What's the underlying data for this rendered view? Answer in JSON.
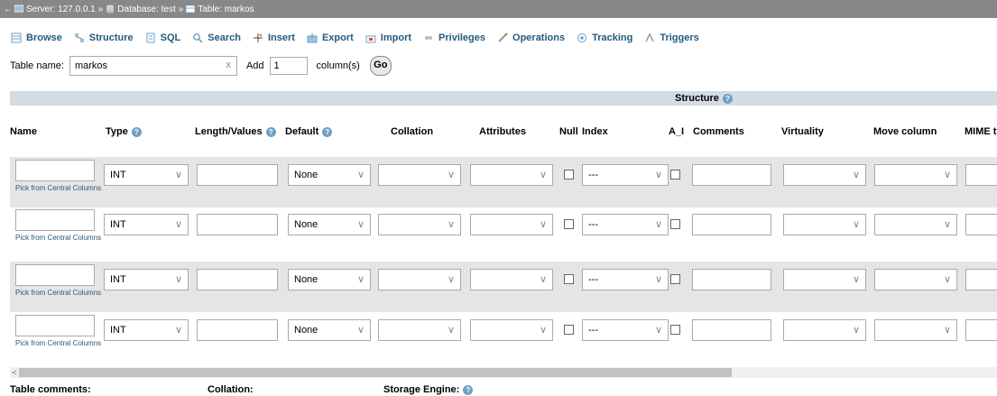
{
  "breadcrumb": {
    "server": "Server: 127.0.0.1",
    "database": "Database: test",
    "table": "Table: markos",
    "sep": "»"
  },
  "tabs": [
    {
      "label": "Browse",
      "icon": "browse-icon"
    },
    {
      "label": "Structure",
      "icon": "structure-icon"
    },
    {
      "label": "SQL",
      "icon": "sql-icon"
    },
    {
      "label": "Search",
      "icon": "search-icon"
    },
    {
      "label": "Insert",
      "icon": "insert-icon"
    },
    {
      "label": "Export",
      "icon": "export-icon"
    },
    {
      "label": "Import",
      "icon": "import-icon"
    },
    {
      "label": "Privileges",
      "icon": "privileges-icon"
    },
    {
      "label": "Operations",
      "icon": "operations-icon"
    },
    {
      "label": "Tracking",
      "icon": "tracking-icon"
    },
    {
      "label": "Triggers",
      "icon": "triggers-icon"
    }
  ],
  "table_name": {
    "label": "Table name:",
    "value": "markos",
    "clear": "x"
  },
  "add_columns": {
    "label": "Add",
    "count": "1",
    "suffix": "column(s)",
    "go": "Go"
  },
  "structure_label": "Structure",
  "headers": {
    "name": "Name",
    "type": "Type",
    "length": "Length/Values",
    "default": "Default",
    "collation": "Collation",
    "attributes": "Attributes",
    "null": "Null",
    "index": "Index",
    "ai": "A_I",
    "comments": "Comments",
    "virtuality": "Virtuality",
    "move": "Move column",
    "mime": "MIME typ"
  },
  "rows": [
    {
      "type": "INT",
      "default": "None",
      "index": "---",
      "pick": "Pick from Central Columns"
    },
    {
      "type": "INT",
      "default": "None",
      "index": "---",
      "pick": "Pick from Central Columns"
    },
    {
      "type": "INT",
      "default": "None",
      "index": "---",
      "pick": "Pick from Central Columns"
    },
    {
      "type": "INT",
      "default": "None",
      "index": "---",
      "pick": "Pick from Central Columns"
    }
  ],
  "footer": {
    "comments": "Table comments:",
    "collation": "Collation:",
    "engine": "Storage Engine:"
  },
  "scroll_left": "<",
  "chevron": "∨",
  "colors": {
    "accent": "#235a81",
    "header_bar": "#888888",
    "structure_bar": "#d3dce3",
    "row_shade": "#e5e5e5"
  }
}
